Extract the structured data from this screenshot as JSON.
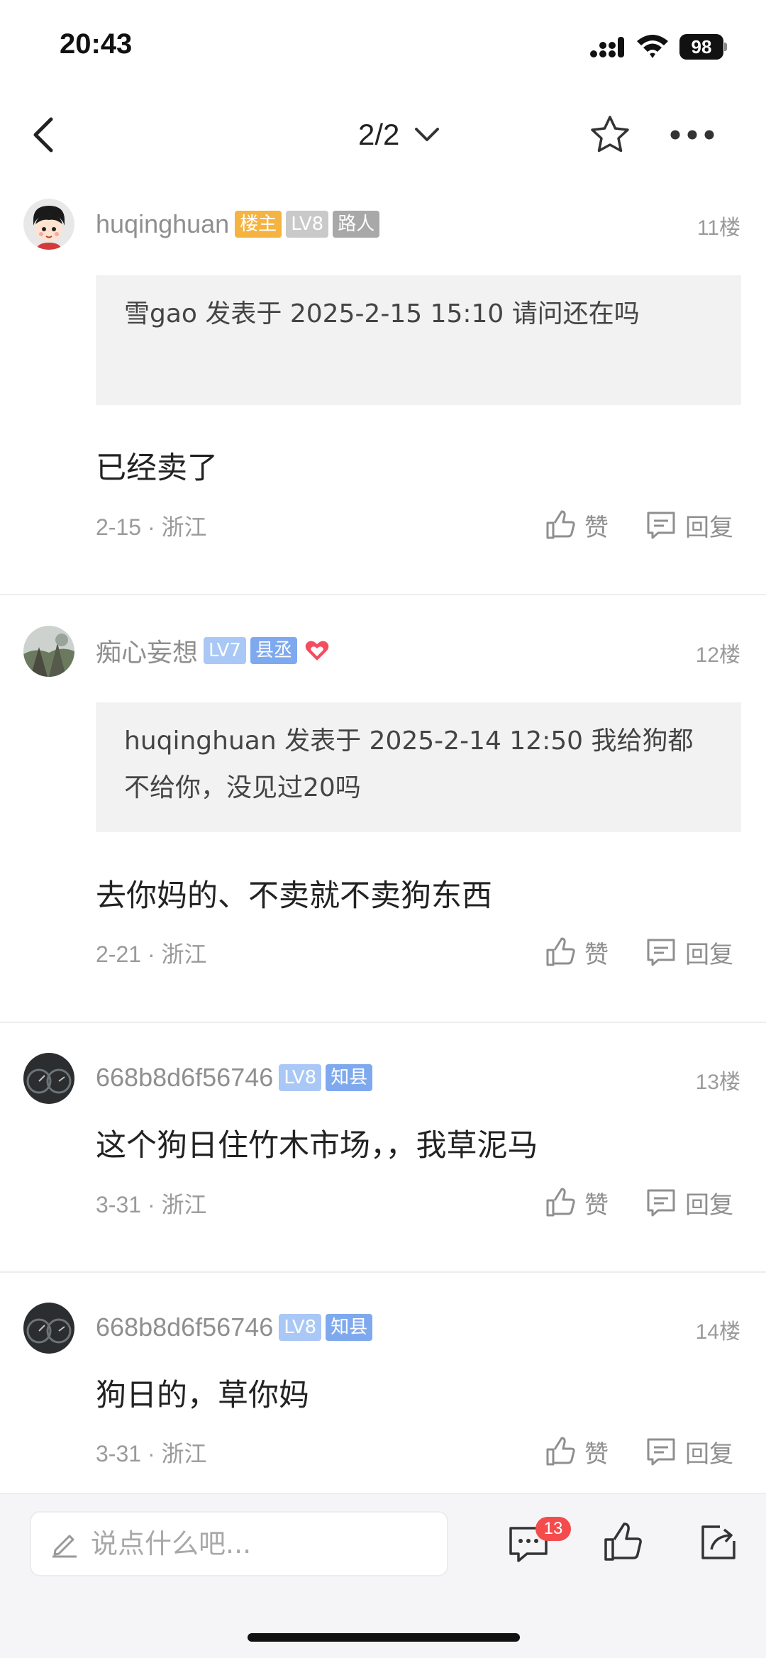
{
  "status": {
    "time": "20:43",
    "battery": "98"
  },
  "nav": {
    "pager": "2/2"
  },
  "labels": {
    "like": "赞",
    "reply": "回复"
  },
  "colors": {
    "badge_owner": "#f5b342",
    "badge_level_grey": "#c9c9c9",
    "badge_title_grey": "#a8a8a8",
    "badge_level_blue": "#a9c8f5",
    "badge_title_blue": "#7fa9ee",
    "heart": "#f44c60",
    "comment_badge": "#f44c4c"
  },
  "posts": [
    {
      "username": "huqinghuan",
      "badges": [
        "楼主",
        "LV8",
        "路人"
      ],
      "floor": "11楼",
      "quote": "雪gao 发表于 2025-2-15 15:10 请问还在吗",
      "content": "已经卖了",
      "meta": "2-15 · 浙江"
    },
    {
      "username": "痴心妄想",
      "badges": [
        "LV7",
        "县丞"
      ],
      "floor": "12楼",
      "quote": "huqinghuan 发表于 2025-2-14 12:50 我给狗都不给你，没见过20吗",
      "content": "去你妈的、不卖就不卖狗东西",
      "meta": "2-21 · 浙江"
    },
    {
      "username": "668b8d6f56746",
      "badges": [
        "LV8",
        "知县"
      ],
      "floor": "13楼",
      "content": "这个狗日住竹木市场，，我草泥马",
      "meta": "3-31 · 浙江"
    },
    {
      "username": "668b8d6f56746",
      "badges": [
        "LV8",
        "知县"
      ],
      "floor": "14楼",
      "content": "狗日的，草你妈",
      "meta": "3-31 · 浙江"
    }
  ],
  "bottom": {
    "placeholder": "说点什么吧...",
    "comment_count": "13"
  }
}
